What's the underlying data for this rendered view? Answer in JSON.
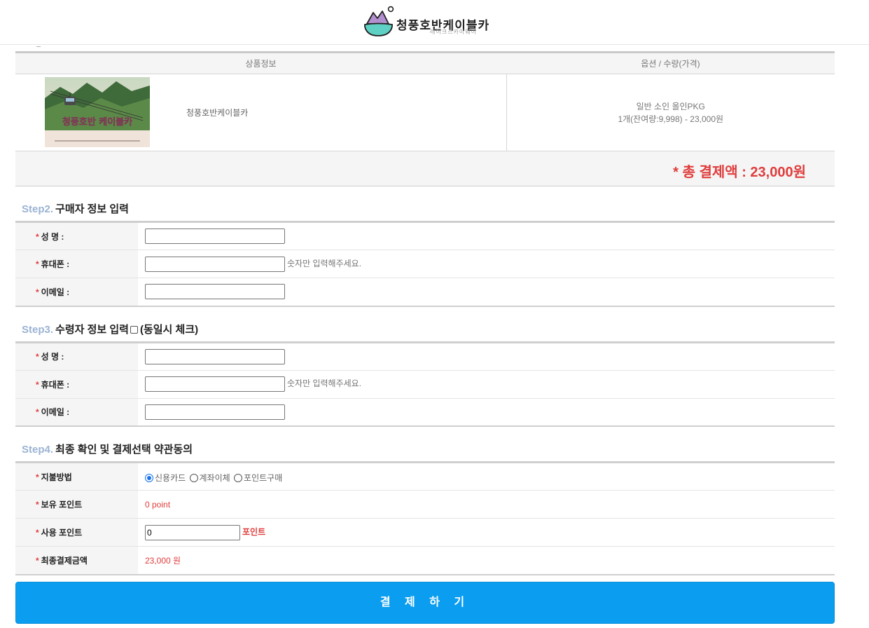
{
  "header": {
    "brand_title": "청풍호반케이블카",
    "brand_subtitle": "레이크스카이웨이"
  },
  "product_table": {
    "col_product": "상품정보",
    "col_option": "옵션 / 수량(가격)",
    "rows": [
      {
        "name": "청풍호반케이블카",
        "image_caption": "청풍호반 케이블카",
        "option": "일반 소인 올인PKG",
        "quantity_price": "1개(잔여량:9,998) - 23,000원"
      }
    ],
    "total_label": "* 총 결제액 : 23,000원"
  },
  "step2": {
    "num": "Step2.",
    "title": "구매자 정보 입력",
    "fields": {
      "name_label": "성  명 :",
      "phone_label": "휴대폰 :",
      "phone_hint": "숫자만 입력해주세요.",
      "email_label": "이메일 :"
    },
    "values": {
      "name": "",
      "phone": "",
      "email": ""
    }
  },
  "step3": {
    "num": "Step3.",
    "title": "수령자 정보 입력",
    "same_label": "(동일시 체크)",
    "same_checked": false,
    "fields": {
      "name_label": "성  명 :",
      "phone_label": "휴대폰 :",
      "phone_hint": "숫자만 입력해주세요.",
      "email_label": "이메일 :"
    },
    "values": {
      "name": "",
      "phone": "",
      "email": ""
    }
  },
  "step4": {
    "num": "Step4.",
    "title": "최종 확인 및 결제선택 약관동의",
    "pay_method_label": "지불방법",
    "pay_methods": [
      "신용카드",
      "계좌이체",
      "포인트구매"
    ],
    "pay_method_selected": "신용카드",
    "owned_points_label": "보유 포인트",
    "owned_points_value": "0 point",
    "use_points_label": "사용 포인트",
    "use_points_value": "0",
    "use_points_unit": "포인트",
    "final_amount_label": "최종결제금액",
    "final_amount_value": "23,000 원"
  },
  "pay_button_label": "결 제 하 기",
  "colors": {
    "accent_red": "#e03c3c",
    "step_num": "#9bb3d4",
    "pay_button": "#0a9df0",
    "radio_selected": "#1a73e8"
  }
}
